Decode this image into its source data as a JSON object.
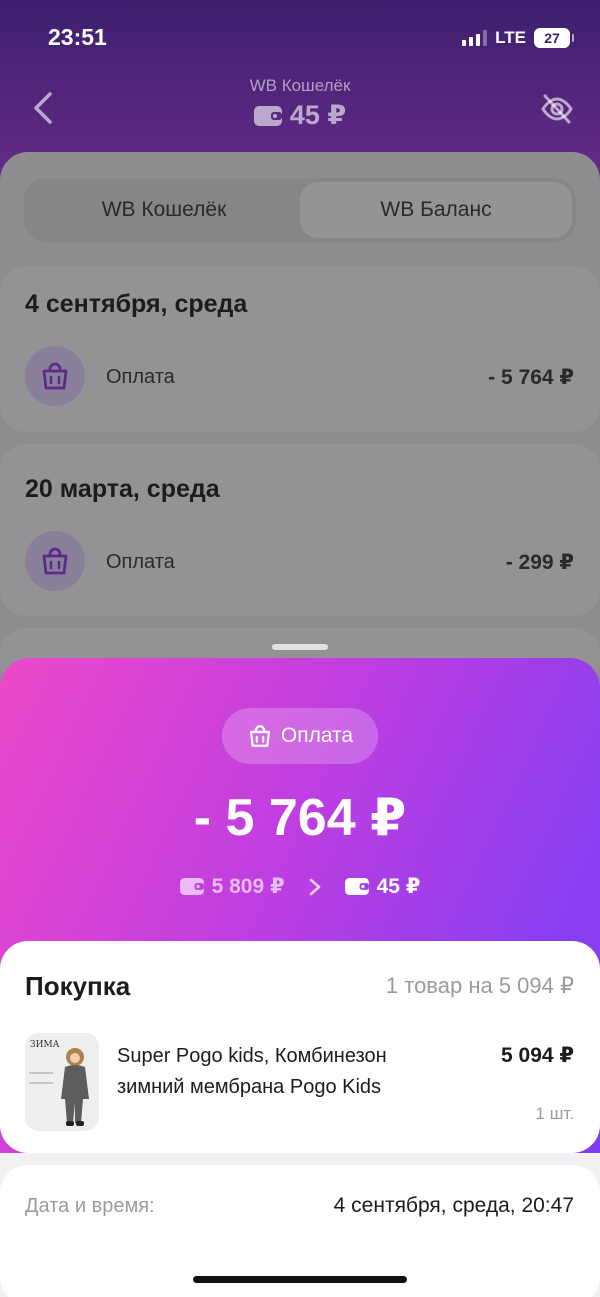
{
  "status_bar": {
    "time": "23:51",
    "network": "LTE",
    "battery": "27"
  },
  "header": {
    "wallet_title": "WB Кошелёк",
    "wallet_balance": "45 ₽"
  },
  "tabs": [
    {
      "label": "WB Кошелёк",
      "active": false
    },
    {
      "label": "WB Баланс",
      "active": true
    }
  ],
  "transactions": [
    {
      "date": "4 сентября, среда",
      "label": "Оплата",
      "amount": "- 5 764 ₽"
    },
    {
      "date": "20 марта, среда",
      "label": "Оплата",
      "amount": "- 299 ₽"
    }
  ],
  "sheet": {
    "type_label": "Оплата",
    "amount": "- 5 764 ₽",
    "balance_from": "5 809 ₽",
    "balance_to": "45 ₽",
    "purchase": {
      "title": "Покупка",
      "summary": "1 товар на 5 094 ₽",
      "product_name": "Super Pogo kids, Комбинезон зимний мембрана Pogo Kids",
      "product_price": "5 094 ₽",
      "product_qty": "1 шт.",
      "product_image_caption": "ЗИМА"
    },
    "datetime": {
      "label": "Дата и время:",
      "value": "4 сентября, среда, 20:47"
    }
  },
  "colors": {
    "header_top": "#3d1f6e",
    "sheet_gradient_start": "#ec49c8",
    "sheet_gradient_end": "#7a3af2",
    "icon_purple": "#6a2fb0"
  },
  "icons": [
    "back-chevron-icon",
    "eye-off-icon",
    "wallet-icon",
    "shopping-bag-icon",
    "chevron-right-icon"
  ]
}
